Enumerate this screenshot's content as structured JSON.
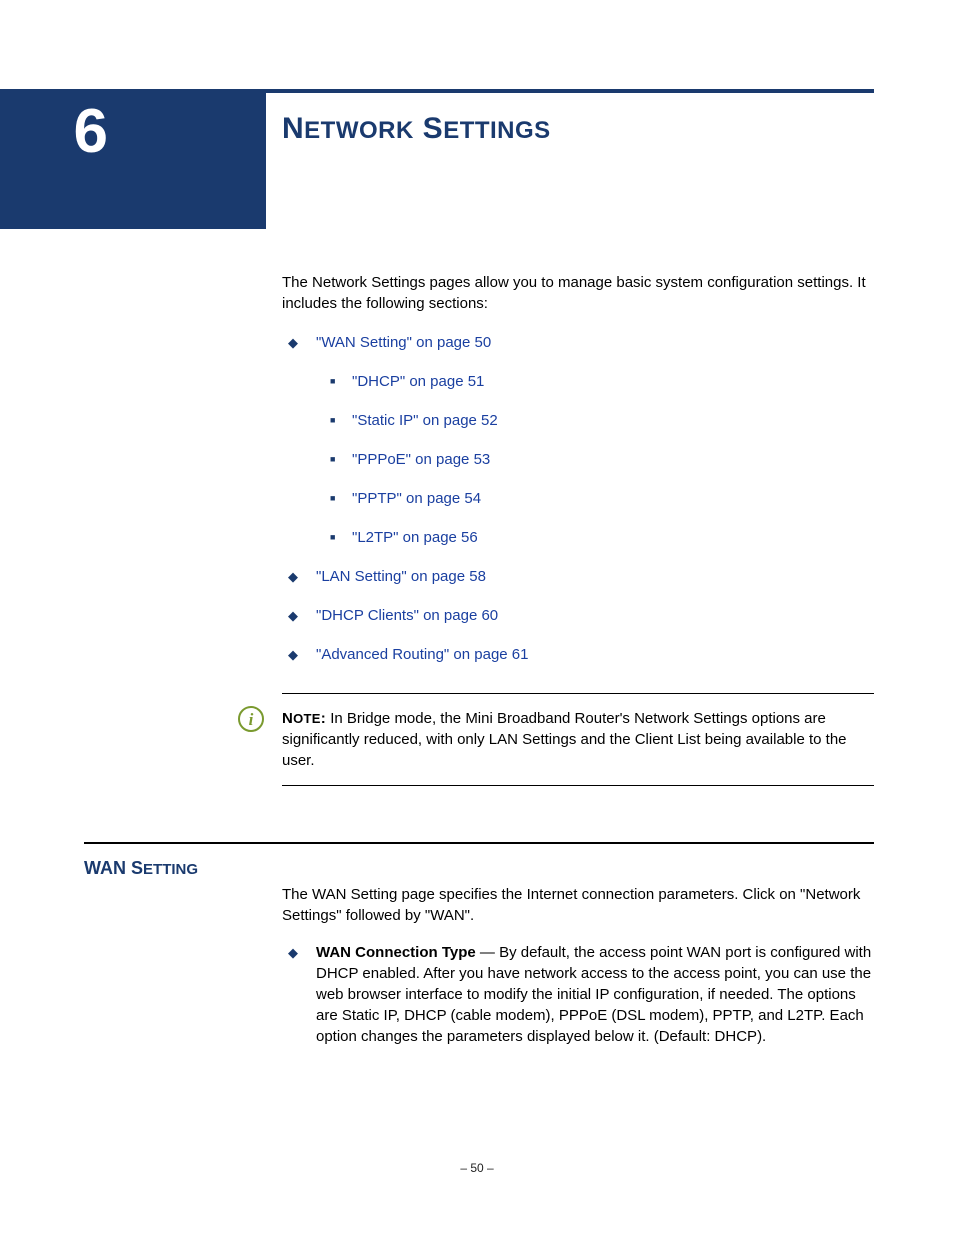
{
  "chapter": {
    "number": "6",
    "title_main": "N",
    "title_rest1": "ETWORK",
    "title_space": " ",
    "title_main2": "S",
    "title_rest2": "ETTINGS"
  },
  "intro": "The Network Settings pages allow you to manage basic system configuration settings. It includes the following sections:",
  "toc": [
    {
      "label": "\"WAN Setting\" on page 50",
      "children": [
        "\"DHCP\" on page 51",
        "\"Static IP\" on page 52",
        "\"PPPoE\" on page 53",
        "\"PPTP\" on page 54",
        "\"L2TP\" on page 56"
      ]
    },
    {
      "label": "\"LAN Setting\" on page 58"
    },
    {
      "label": "\"DHCP Clients\" on page 60"
    },
    {
      "label": "\"Advanced Routing\" on page 61"
    }
  ],
  "note": {
    "label_main": "N",
    "label_rest": "OTE",
    "glyph": "i",
    "text": "In Bridge mode, the Mini Broadband Router's Network Settings options are significantly reduced, with only LAN Settings and the Client List being available to the user."
  },
  "section": {
    "heading_main1": "WAN",
    "heading_space": " ",
    "heading_main2": "S",
    "heading_rest": "ETTING",
    "intro": "The WAN Setting page specifies the Internet connection parameters. Click on \"Network Settings\" followed by \"WAN\".",
    "bullet": {
      "term": "WAN Connection Type",
      "text": " — By default, the access point WAN port is configured with DHCP enabled. After you have network access to the access point, you can use the web browser interface to modify the initial IP configuration, if needed. The options are Static IP, DHCP (cable modem), PPPoE (DSL modem), PPTP, and L2TP. Each option changes the parameters displayed below it. (Default: DHCP)."
    }
  },
  "page_number": "–  50  –"
}
